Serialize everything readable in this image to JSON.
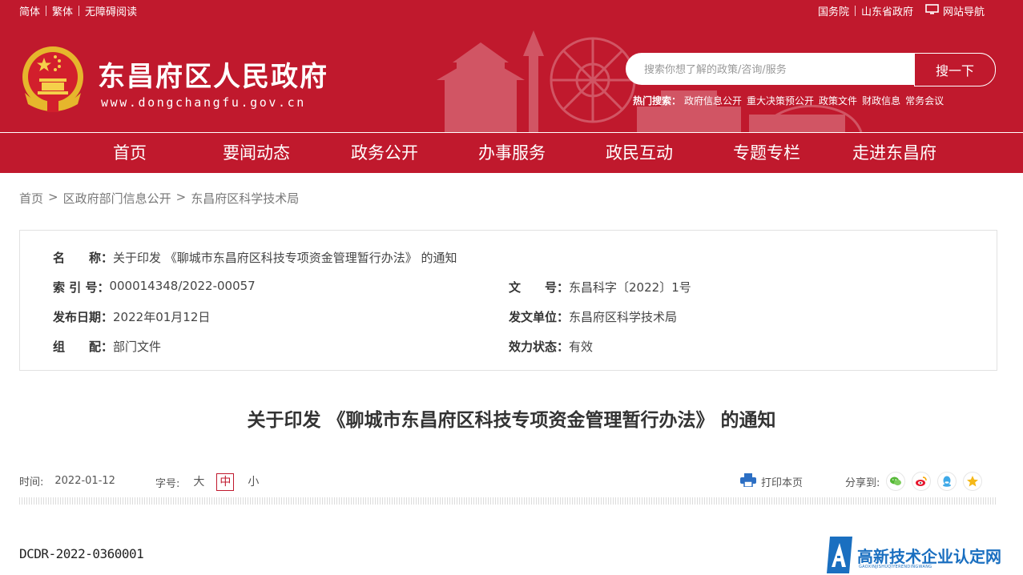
{
  "topbar": {
    "left_links": [
      "简体",
      "繁体",
      "无障碍阅读"
    ],
    "right_links": [
      "国务院",
      "山东省政府"
    ],
    "nav_link": "网站导航"
  },
  "site": {
    "title": "东昌府区人民政府",
    "url": "www.dongchangfu.gov.cn"
  },
  "search": {
    "placeholder": "搜索你想了解的政策/咨询/服务",
    "button": "搜一下",
    "hot_label": "热门搜索：",
    "hot_items": [
      "政府信息公开",
      "重大决策预公开",
      "政策文件",
      "财政信息",
      "常务会议"
    ]
  },
  "nav": [
    "首页",
    "要闻动态",
    "政务公开",
    "办事服务",
    "政民互动",
    "专题专栏",
    "走进东昌府"
  ],
  "breadcrumb": {
    "items": [
      "首页",
      "区政府部门信息公开",
      "东昌府区科学技术局"
    ],
    "separator": ">"
  },
  "info": {
    "name_label": "名　　称：",
    "name_value": "关于印发 《聊城市东昌府区科技专项资金管理暂行办法》 的通知",
    "index_label": "索 引 号：",
    "index_value": "000014348/2022-00057",
    "docno_label": "文　　号：",
    "docno_value": "东昌科字〔2022〕1号",
    "date_label": "发布日期：",
    "date_value": "2022年01月12日",
    "unit_label": "发文单位：",
    "unit_value": "东昌府区科学技术局",
    "group_label": "组　　配：",
    "group_value": "部门文件",
    "status_label": "效力状态：",
    "status_value": "有效"
  },
  "article": {
    "title": "关于印发 《聊城市东昌府区科技专项资金管理暂行办法》 的通知",
    "time_label": "时间:",
    "time_value": "2022-01-12",
    "font_label": "字号:",
    "font_sizes": [
      "大",
      "中",
      "小"
    ],
    "font_selected": "中",
    "print": "打印本页",
    "share_label": "分享到:",
    "share_icons": [
      "wechat-icon",
      "weibo-icon",
      "qq-icon",
      "qzone-icon"
    ],
    "doc_code": "DCDR-2022-0360001"
  },
  "watermark": {
    "text": "高新技术企业认定网",
    "sub": "GAOXINJISHUQIYERENDINGWANG"
  },
  "colors": {
    "brand_red": "#c0192d",
    "watermark_blue": "#1a6fc0"
  }
}
